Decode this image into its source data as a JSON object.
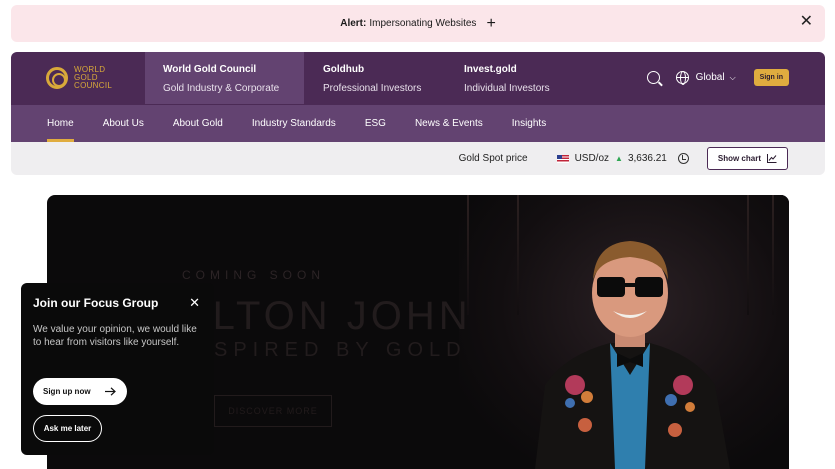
{
  "alert": {
    "label": "Alert:",
    "text": "Impersonating Websites",
    "plus_icon": "+",
    "close_icon": "✕"
  },
  "logo": {
    "line1": "WORLD",
    "line2": "GOLD",
    "line3": "COUNCIL"
  },
  "site_tabs": [
    {
      "title": "World Gold Council",
      "subtitle": "Gold Industry & Corporate"
    },
    {
      "title": "Goldhub",
      "subtitle": "Professional Investors"
    },
    {
      "title": "Invest.gold",
      "subtitle": "Individual Investors"
    }
  ],
  "header_right": {
    "region": "Global",
    "signin": "Sign in"
  },
  "nav": [
    "Home",
    "About Us",
    "About Gold",
    "Industry Standards",
    "ESG",
    "News & Events",
    "Insights"
  ],
  "price": {
    "label": "Gold Spot price",
    "currency": "USD/oz",
    "value": "3,636.21",
    "show_chart": "Show chart"
  },
  "hero": {
    "kicker": "COMING SOON",
    "headline1": "ELTON JOHN",
    "headline2": "INSPIRED BY GOLD",
    "button": "DISCOVER MORE"
  },
  "focus": {
    "title": "Join our Focus Group",
    "close_icon": "✕",
    "description": "We value your opinion, we would like to hear from visitors like yourself.",
    "signup": "Sign up now",
    "later": "Ask me later"
  },
  "colors": {
    "header": "#4b2a55",
    "nav": "#634371",
    "gold": "#e0ac3f",
    "alert_bg": "#fbe6ea"
  }
}
